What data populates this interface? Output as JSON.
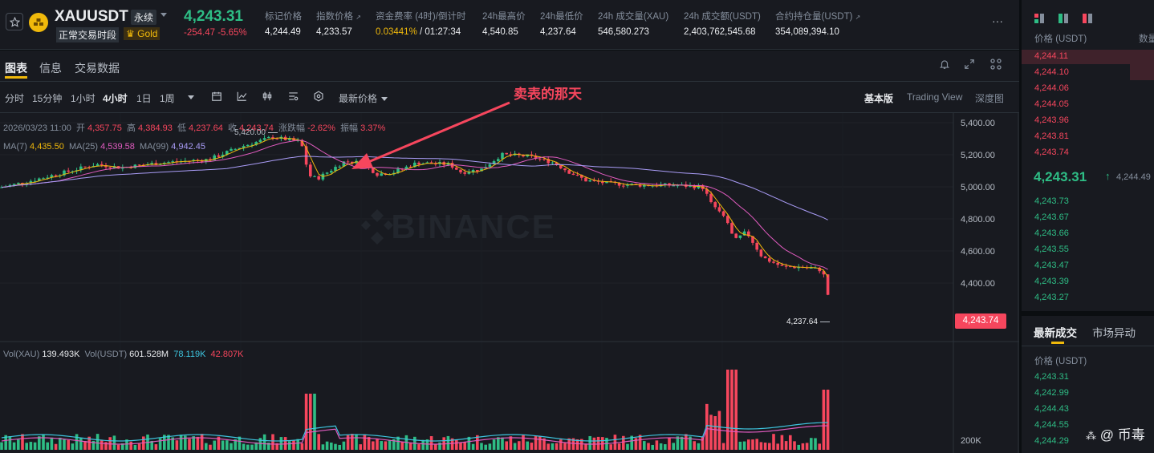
{
  "header": {
    "symbol": "XAUUSDT",
    "contract_type": "永续",
    "session_badge": "正常交易时段",
    "asset_tag": "Gold",
    "last_price": "4,243.31",
    "change": "-254.47",
    "change_pct": "-5.65%",
    "stats": [
      {
        "label": "标记价格",
        "value": "4,244.49"
      },
      {
        "label": "指数价格",
        "value": "4,233.57"
      },
      {
        "label": "资金费率 (4时)/倒计时",
        "value_rate": "0.03441%",
        "value_countdown": " / 01:27:34"
      },
      {
        "label": "24h最高价",
        "value": "4,540.85"
      },
      {
        "label": "24h最低价",
        "value": "4,237.64"
      },
      {
        "label": "24h 成交量(XAU)",
        "value": "546,580.273"
      },
      {
        "label": "24h 成交额(USDT)",
        "value": "2,403,762,545.68"
      },
      {
        "label": "合约持仓量(USDT)",
        "value": "354,089,394.10"
      }
    ],
    "more": "···"
  },
  "tabs": [
    "图表",
    "信息",
    "交易数据"
  ],
  "toolbar": {
    "intervals": [
      "分时",
      "15分钟",
      "1小时",
      "4小时",
      "1日",
      "1周"
    ],
    "active_interval": "4小时",
    "price_type": "最新价格",
    "views": [
      "基本版",
      "Trading View",
      "深度图"
    ],
    "active_view": "基本版"
  },
  "annotation": "卖表的那天",
  "ohlc": {
    "date": "2026/03/23 11:00",
    "open_label": "开",
    "open": "4,357.75",
    "high_label": "高",
    "high": "4,384.93",
    "low_label": "低",
    "low": "4,237.64",
    "close_label": "收",
    "close": "4,243.74",
    "chg_label": "涨跌幅",
    "chg": "-2.62%",
    "amp_label": "振幅",
    "amp": "3.37%"
  },
  "ma": {
    "ma7_label": "MA(7)",
    "ma7": "4,435.50",
    "ma25_label": "MA(25)",
    "ma25": "4,539.58",
    "ma99_label": "MA(99)",
    "ma99": "4,942.45"
  },
  "vol": {
    "label1": "Vol(XAU)",
    "v1": "139.493K",
    "label2": "Vol(USDT)",
    "v2": "601.528M",
    "v3": "78.119K",
    "v4": "42.807K"
  },
  "watermark": "BINANCE",
  "price_axis": [
    "5,400.00",
    "5,200.00",
    "5,000.00",
    "4,800.00",
    "4,600.00",
    "4,400.00"
  ],
  "vol_axis": "200K",
  "current_price_tag": "4,243.74",
  "high_marker": "5,420.00",
  "low_marker": "4,237.64",
  "orderbook": {
    "col_price": "价格 (USDT)",
    "col_qty": "数量",
    "asks": [
      "4,244.11",
      "4,244.10",
      "4,244.06",
      "4,244.05",
      "4,243.96",
      "4,243.81",
      "4,243.74"
    ],
    "mid_price": "4,243.31",
    "mid_mark": "4,244.49",
    "bids": [
      "4,243.73",
      "4,243.67",
      "4,243.66",
      "4,243.55",
      "4,243.47",
      "4,243.39",
      "4,243.27"
    ]
  },
  "trades": {
    "tabs": [
      "最新成交",
      "市场异动"
    ],
    "col_price": "价格 (USDT)",
    "prices": [
      "4,243.31",
      "4,242.99",
      "4,244.43",
      "4,244.55",
      "4,244.29"
    ]
  },
  "source_watermark": "@ 币毒",
  "colors": {
    "up": "#2ebd85",
    "down": "#f6465d",
    "accent": "#f0b90b",
    "ma7": "#f0b90b",
    "ma25": "#e05bbf",
    "ma99": "#a99cf6"
  }
}
